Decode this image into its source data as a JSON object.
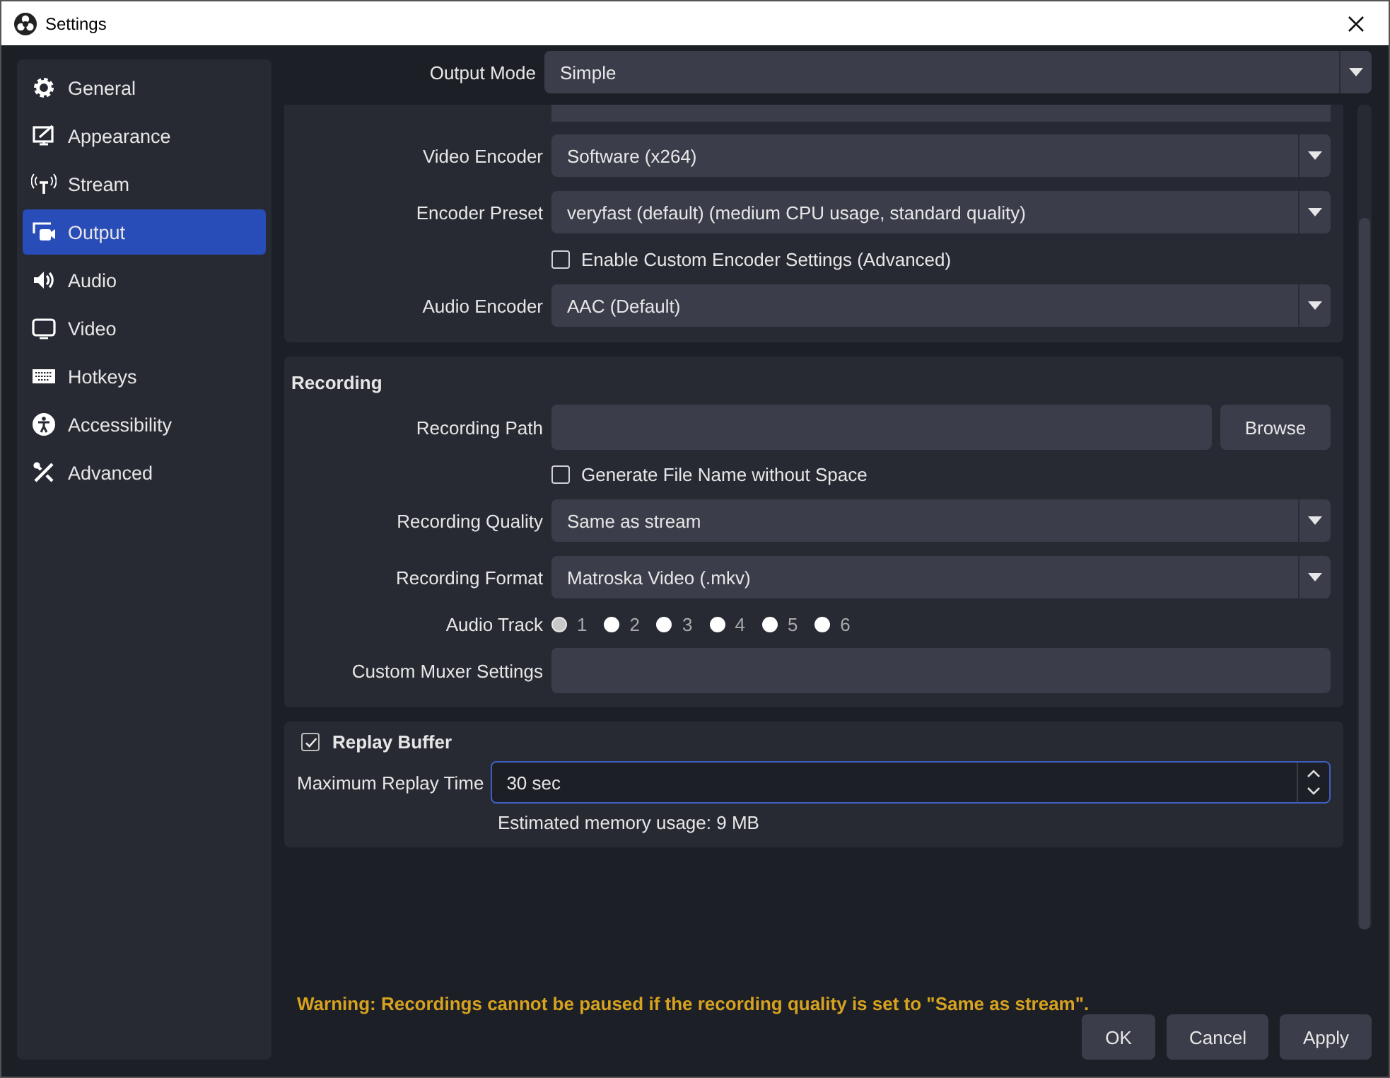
{
  "window": {
    "title": "Settings"
  },
  "sidebar": {
    "items": [
      {
        "label": "General",
        "kind": "gear",
        "selected": false
      },
      {
        "label": "Appearance",
        "kind": "appearance",
        "selected": false
      },
      {
        "label": "Stream",
        "kind": "antenna",
        "selected": false
      },
      {
        "label": "Output",
        "kind": "output",
        "selected": true
      },
      {
        "label": "Audio",
        "kind": "speaker",
        "selected": false
      },
      {
        "label": "Video",
        "kind": "monitor",
        "selected": false
      },
      {
        "label": "Hotkeys",
        "kind": "keyboard",
        "selected": false
      },
      {
        "label": "Accessibility",
        "kind": "accessibility",
        "selected": false
      },
      {
        "label": "Advanced",
        "kind": "tools",
        "selected": false
      }
    ]
  },
  "output_mode": {
    "label": "Output Mode",
    "value": "Simple"
  },
  "streaming_rows": [
    {
      "kind": "select",
      "label": "Video Encoder",
      "value": "Software (x264)"
    },
    {
      "kind": "select",
      "label": "Encoder Preset",
      "value": "veryfast (default) (medium CPU usage, standard quality)"
    },
    {
      "kind": "checkbox",
      "label": "Enable Custom Encoder Settings (Advanced)",
      "checked": false
    },
    {
      "kind": "select",
      "label": "Audio Encoder",
      "value": "AAC (Default)"
    }
  ],
  "recording": {
    "title": "Recording",
    "rows": [
      {
        "kind": "path",
        "label": "Recording Path",
        "button": "Browse"
      },
      {
        "kind": "checkbox",
        "label": "Generate File Name without Space",
        "checked": false
      },
      {
        "kind": "select",
        "label": "Recording Quality",
        "value": "Same as stream"
      },
      {
        "kind": "select",
        "label": "Recording Format",
        "value": "Matroska Video (.mkv)"
      },
      {
        "kind": "tracks",
        "label": "Audio Track",
        "tracks": [
          {
            "label": "1",
            "selected": true
          },
          {
            "label": "2",
            "selected": false
          },
          {
            "label": "3",
            "selected": false
          },
          {
            "label": "4",
            "selected": false
          },
          {
            "label": "5",
            "selected": false
          },
          {
            "label": "6",
            "selected": false
          }
        ]
      },
      {
        "kind": "text",
        "label": "Custom Muxer Settings"
      }
    ]
  },
  "replay_buffer": {
    "title": "Replay Buffer",
    "checked": true,
    "label": "Maximum Replay Time",
    "value": "30 sec",
    "note": "Estimated memory usage: 9 MB"
  },
  "warning": "Warning: Recordings cannot be paused if the recording quality is set to \"Same as stream\".",
  "buttons": [
    "OK",
    "Cancel",
    "Apply"
  ]
}
